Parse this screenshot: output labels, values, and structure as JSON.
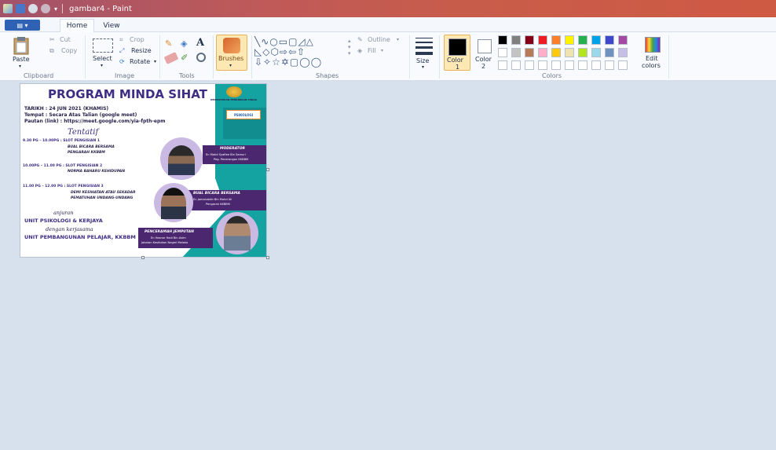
{
  "window": {
    "title": "gambar4 - Paint"
  },
  "tabs": [
    {
      "label": "Home"
    },
    {
      "label": "View"
    }
  ],
  "file_menu": {
    "label": "▤ ▾"
  },
  "ribbon": {
    "clipboard": {
      "paste": "Paste",
      "cut": "Cut",
      "copy": "Copy",
      "label": "Clipboard"
    },
    "image": {
      "select": "Select",
      "crop": "Crop",
      "resize": "Resize",
      "rotate": "Rotate",
      "label": "Image"
    },
    "tools": {
      "label": "Tools"
    },
    "brushes": {
      "label": "Brushes"
    },
    "shapes": {
      "outline": "Outline",
      "fill": "Fill",
      "label": "Shapes"
    },
    "size": {
      "label": "Size"
    },
    "color1": {
      "line1": "Color",
      "line2": "1"
    },
    "color2": {
      "line1": "Color",
      "line2": "2"
    },
    "edit_colors": {
      "line1": "Edit",
      "line2": "colors"
    },
    "colors_label": "Colors"
  },
  "palette_row1": [
    "#000000",
    "#7f7f7f",
    "#880015",
    "#ed1c24",
    "#ff7f27",
    "#fff200",
    "#22b14c",
    "#00a2e8",
    "#3f48cc",
    "#a349a4"
  ],
  "palette_row2": [
    "#ffffff",
    "#c3c3c3",
    "#b97a57",
    "#ffaec9",
    "#ffc90e",
    "#efe4b0",
    "#b5e61d",
    "#99d9ea",
    "#7092be",
    "#c8bfe7"
  ],
  "color1": "#000000",
  "color2": "#ffffff",
  "poster": {
    "title": "PROGRAM MINDA SIHAT",
    "ministry": "KEMENTERIAN PENDIDIKAN TINGGI",
    "logo_text": "PSIKOLOGI",
    "date": "TARIKH   : 24 JUN 2021 (KHAMIS)",
    "place": "Tempat  : Secara Atas Talian (google meet)",
    "link": "Pautan (link)  : https://meet.google.com/yia-fpth-epm",
    "tentatif": "Tentatif",
    "slot1_time": "9.30 PG – 10.00PG : SLOT PENGISIAN 1",
    "slot1_a": "BUAL BICARA BERSAMA",
    "slot1_b": "PENGARAH KKBBM",
    "slot2_time": "10.00PG – 11.00 PG : SLOT PENGISIAN 2",
    "slot2_a": "NORMA BAHARU KEHIDUPAN",
    "slot3_time": "11.00 PG – 12.00 PG   : SLOT PENGISIAN 3",
    "slot3_a": "DEMI KESIHATAN ATAU SEKADAR",
    "slot3_b": "PEMATUHAN UNDANG-UNDANG",
    "anjuran": "anjuran",
    "org1": "UNIT PSIKOLOGI & KERJAYA",
    "kerjasama": "dengan kerjasama",
    "org2": "UNIT PEMBANGUNAN PELAJAR, KKBBM",
    "mod_title": "MODERATOR",
    "mod_name": "En Mohd Syafiee Bin Samuri",
    "mod_role": "Peg. Penerangan KKBBM",
    "bual_title": "BUAL BICARA BERSAMA",
    "bual_name": "En Jamaluddin Bin Mohd Ali",
    "bual_role": "Pengarah KKBBM",
    "pen_title": "PENCERAMAH JEMPUTAN",
    "pen_name": "En Hasnor Hadi Bin Asim",
    "pen_role": "Jabatan Kesihatan Negeri Melaka"
  }
}
